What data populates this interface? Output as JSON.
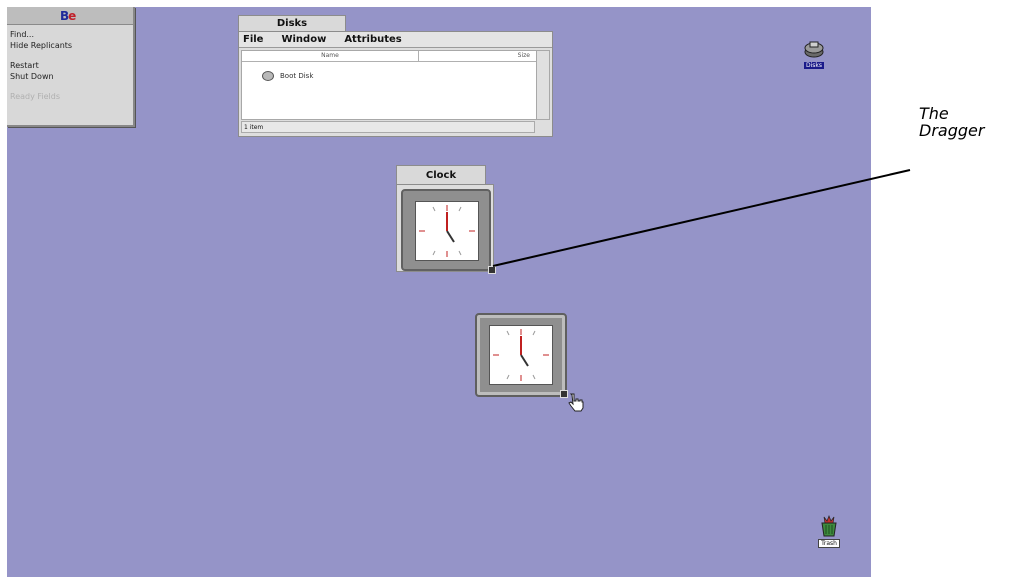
{
  "deskbar": {
    "logo_b": "B",
    "logo_e": "e",
    "items": [
      "Find...",
      "Hide Replicants",
      "Restart",
      "Shut Down",
      "Ready Fields"
    ]
  },
  "disks_window": {
    "title": "Disks",
    "menus": [
      "File",
      "Window",
      "Attributes"
    ],
    "columns": [
      "Name",
      "Size"
    ],
    "rows": [
      {
        "name": "Boot Disk"
      }
    ],
    "status": "1 item"
  },
  "clock_window": {
    "title": "Clock"
  },
  "desktop_icons": {
    "top_right_label": "Disks",
    "trash_label": "Trash"
  },
  "callout": {
    "line1": "The",
    "line2": "Dragger"
  },
  "colors": {
    "desktop": "#9594c8",
    "window": "#dddddd",
    "hand_red": "#c02020"
  },
  "icons": [
    "disk-icon",
    "pointing-hand-cursor-icon",
    "clock-face-icon",
    "trash-icon",
    "disks-desktop-icon"
  ]
}
